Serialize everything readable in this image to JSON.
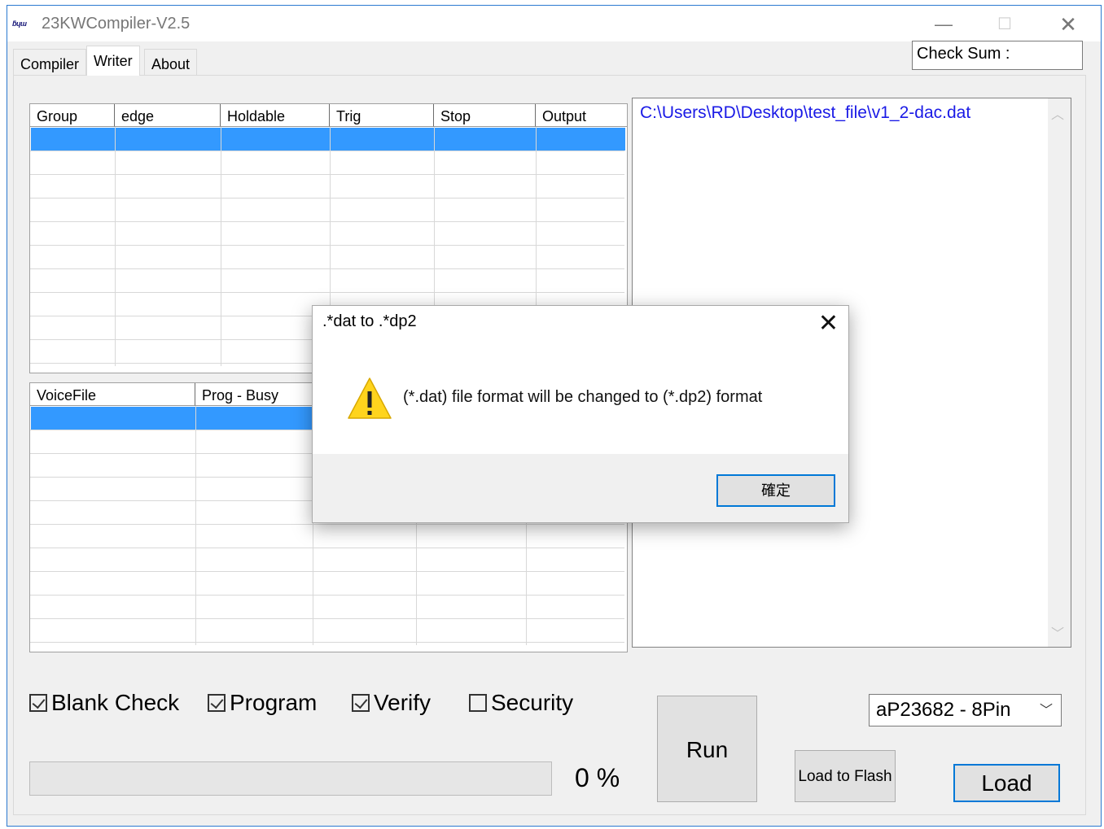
{
  "window": {
    "logo_text": "ƃɥɯ",
    "title": "23KWCompiler-V2.5",
    "minimize": "—",
    "maximize": "☐",
    "close": "✕"
  },
  "tabs": [
    "Compiler",
    "Writer",
    "About"
  ],
  "active_tab": "Writer",
  "checksum": {
    "label": "Check Sum :"
  },
  "table_top": {
    "columns": [
      "Group",
      "edge",
      "Holdable",
      "Trig",
      "Stop",
      "Output"
    ],
    "selected_row": 0
  },
  "table_bottom": {
    "columns": [
      "VoiceFile",
      "Prog - Busy",
      "",
      "",
      ""
    ],
    "selected_row": 0
  },
  "file_panel": {
    "path": "C:\\Users\\RD\\Desktop\\test_file\\v1_2-dac.dat"
  },
  "options": [
    {
      "label": "Blank Check",
      "checked": true
    },
    {
      "label": "Program",
      "checked": true
    },
    {
      "label": "Verify",
      "checked": true
    },
    {
      "label": "Security",
      "checked": false
    }
  ],
  "progress": {
    "value": 0,
    "label": "0 %"
  },
  "buttons": {
    "run": "Run",
    "load_to_flash": "Load to Flash",
    "load": "Load"
  },
  "device_select": {
    "selected": "aP23682 - 8Pin"
  },
  "dialog": {
    "title": ".*dat  to  .*dp2",
    "message": "(*.dat) file format will be changed to (*.dp2) format",
    "ok": "確定",
    "close": "✕"
  },
  "colors": {
    "selection": "#3399ff",
    "accent": "#0078d7",
    "path_text": "#1a1ae6"
  }
}
